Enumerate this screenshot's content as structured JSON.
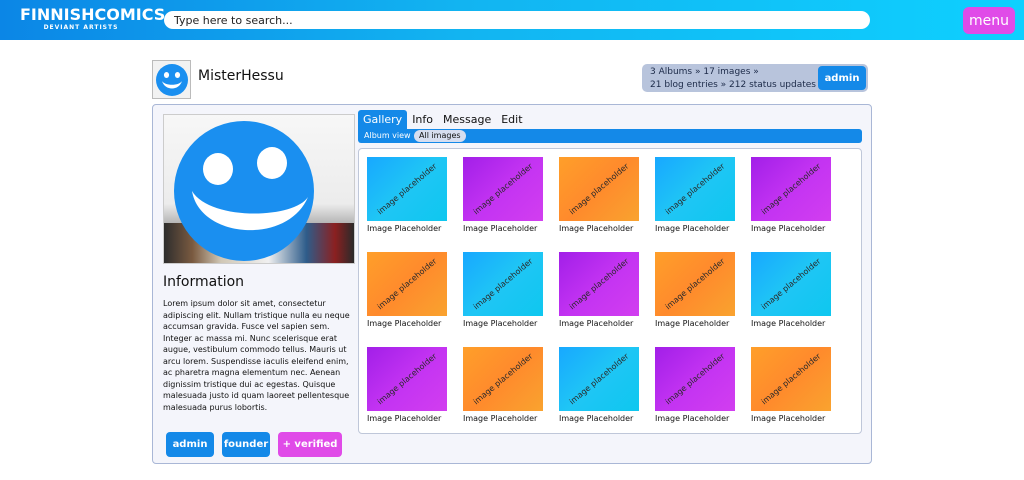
{
  "header": {
    "logo_main": "FINNISHCOMICS",
    "logo_sub": "DEVIANT ARTISTS",
    "search_placeholder": "Type here to search...",
    "menu_label": "menu"
  },
  "profile": {
    "username": "MisterHessu",
    "stats_line1": "3 Albums » 17 images »",
    "stats_line2": "21 blog entries » 212 status updates",
    "top_badge": "admin",
    "info_title": "Information",
    "info_text": "Lorem ipsum dolor sit amet, consectetur adipiscing elit. Nullam tristique nulla eu neque accumsan gravida. Fusce vel sapien sem. Integer ac massa mi. Nunc scelerisque erat augue, vestibulum commodo tellus. Mauris ut arcu lorem. Suspendisse iaculis eleifend enim, ac pharetra magna elementum nec. Aenean dignissim tristique dui ac egestas. Quisque malesuada justo id quam laoreet pellentesque malesuada purus lobortis.",
    "badges": [
      "admin",
      "founder",
      "+ verified"
    ]
  },
  "tabs": [
    "Gallery",
    "Info",
    "Message",
    "Edit"
  ],
  "subbar": {
    "label": "Album view",
    "pill": "All images"
  },
  "gallery": {
    "thumb_text": "image placeholder",
    "caption": "Image Placeholder",
    "colors": {
      "blue": "#18a8ff",
      "purple": "#c333f2",
      "orange": "#ff8a2c"
    },
    "grid": [
      [
        "blue",
        "purple",
        "orange",
        "blue",
        "purple"
      ],
      [
        "orange",
        "blue",
        "purple",
        "orange",
        "blue"
      ],
      [
        "purple",
        "orange",
        "blue",
        "purple",
        "orange"
      ]
    ]
  },
  "accent_colors": {
    "primary_blue": "#1489e8",
    "magenta": "#e04be8"
  }
}
